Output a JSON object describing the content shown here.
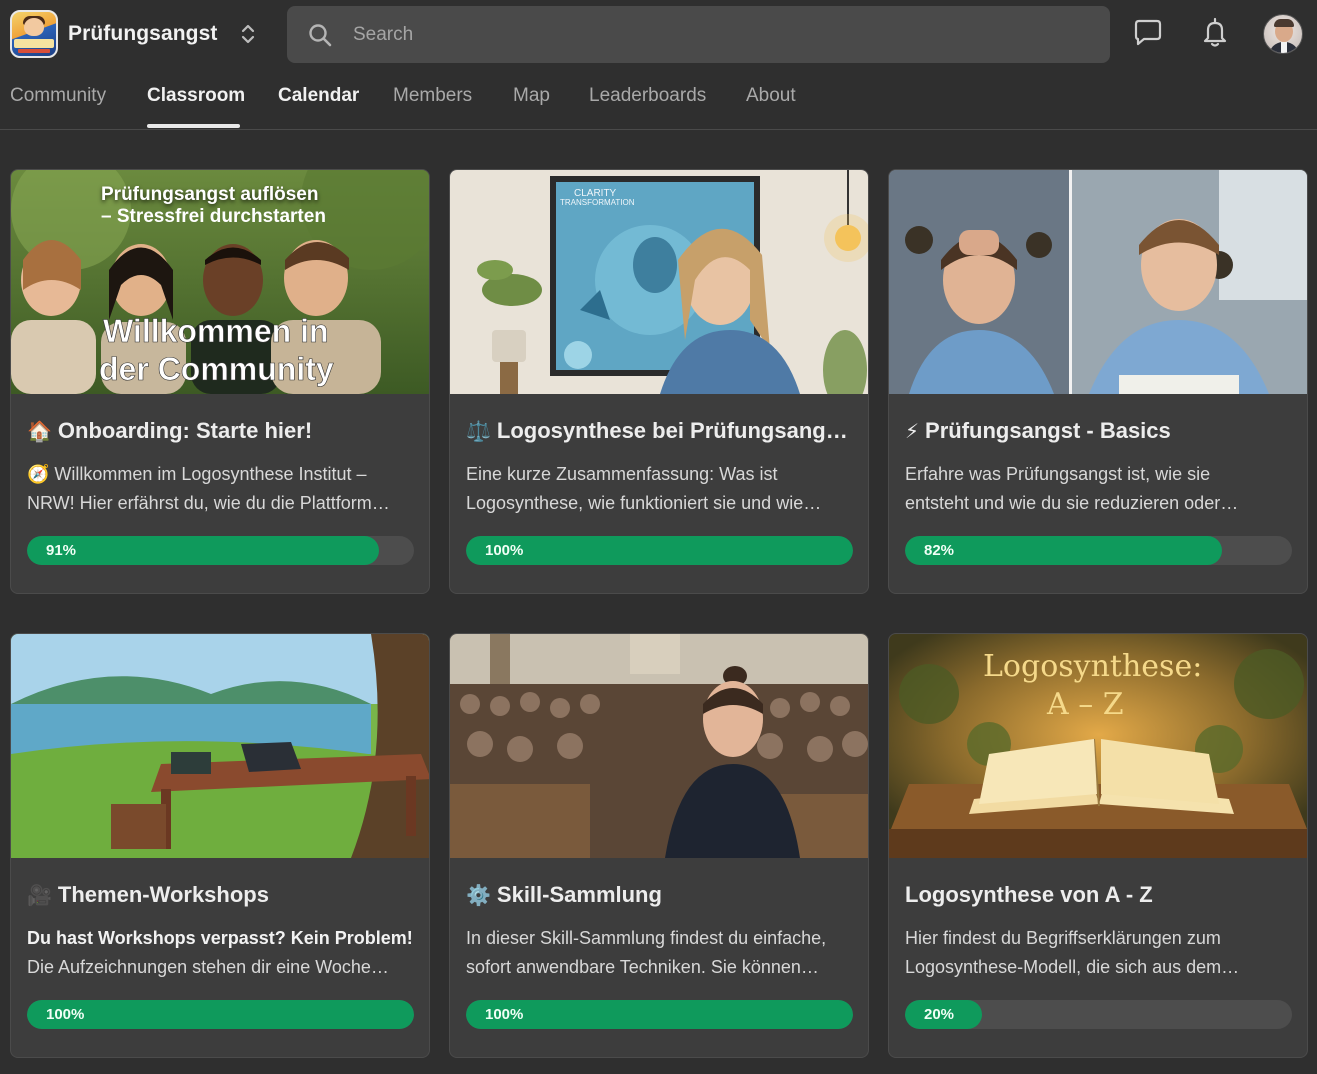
{
  "header": {
    "group_name": "Prüfungsangst",
    "search_placeholder": "Search"
  },
  "tabs": [
    {
      "label": "Community"
    },
    {
      "label": "Classroom"
    },
    {
      "label": "Calendar"
    },
    {
      "label": "Members"
    },
    {
      "label": "Map"
    },
    {
      "label": "Leaderboards"
    },
    {
      "label": "About"
    }
  ],
  "active_tab": "Classroom",
  "colors": {
    "background": "#2f2f2f",
    "card": "#3d3d3d",
    "progress_fill": "#0f9a5c",
    "progress_track": "#4d4d4d"
  },
  "courses": [
    {
      "emoji": "🏠",
      "title": "Onboarding: Starte hier!",
      "desc_line1": "🧭 Willkommen im Logosynthese Institut –",
      "desc_line2": "NRW! Hier erfährst du, wie du die Plattform…",
      "progress": 91,
      "progress_label": "91%",
      "thumb_text_top1": "Prüfungsangst auflösen",
      "thumb_text_top2": "– Stressfrei durchstarten",
      "thumb_text_big1": "Willkommen in",
      "thumb_text_big2": "der Community"
    },
    {
      "emoji": "⚖️",
      "title": "Logosynthese bei Prüfungsang…",
      "desc_line1": "Eine kurze Zusammenfassung: Was ist",
      "desc_line2": "Logosynthese, wie funktioniert sie und wie…",
      "progress": 100,
      "progress_label": "100%",
      "thumb_text_poster1": "CLARITY",
      "thumb_text_poster2": "TRANSFORMATION"
    },
    {
      "emoji": "⚡",
      "title": "Prüfungsangst - Basics",
      "desc_line1": "Erfahre was Prüfungsangst ist, wie sie",
      "desc_line2": "entsteht und wie du sie reduzieren oder…",
      "progress": 82,
      "progress_label": "82%"
    },
    {
      "emoji": "🎥",
      "title": "Themen-Workshops",
      "desc_line1": "Du hast Workshops verpasst? Kein Problem!",
      "desc_line2": "Die Aufzeichnungen stehen dir eine Woche…",
      "progress": 100,
      "progress_label": "100%"
    },
    {
      "emoji": "⚙️",
      "title": "Skill-Sammlung",
      "desc_line1": "In dieser Skill-Sammlung findest du einfache,",
      "desc_line2": "sofort anwendbare Techniken. Sie können…",
      "progress": 100,
      "progress_label": "100%"
    },
    {
      "emoji": "",
      "title": "Logosynthese von A - Z",
      "desc_line1": "Hier findest du Begriffserklärungen zum",
      "desc_line2": "Logosynthese-Modell, die sich aus dem…",
      "progress": 20,
      "progress_label": "20%",
      "thumb_text_1": "Logosynthese:",
      "thumb_text_2": "A – Z"
    }
  ]
}
